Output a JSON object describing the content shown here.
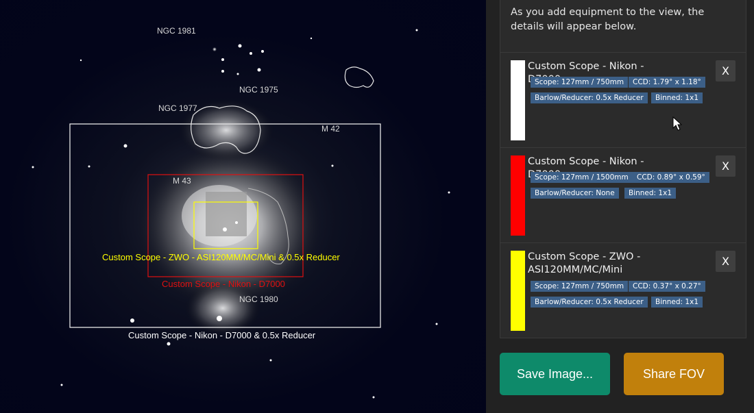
{
  "sky": {
    "objects": [
      {
        "id": "ngc1981",
        "label": "NGC 1981"
      },
      {
        "id": "ngc1975",
        "label": "NGC 1975"
      },
      {
        "id": "ngc1977",
        "label": "NGC 1977"
      },
      {
        "id": "m42",
        "label": "M 42"
      },
      {
        "id": "m43",
        "label": "M 43"
      },
      {
        "id": "ngc1980",
        "label": "NGC 1980"
      }
    ],
    "fov_labels": {
      "yellow": "Custom Scope - ZWO - ASI120MM/MC/Mini  & 0.5x Reducer",
      "red": "Custom Scope - Nikon - D7000",
      "white": "Custom Scope - Nikon - D7000  & 0.5x Reducer"
    },
    "colors": {
      "white": "#ffffff",
      "red": "#e01010",
      "yellow": "#ffff00"
    }
  },
  "sidebar": {
    "intro": "As you add equipment to the view, the details will appear below.",
    "equipment": [
      {
        "name": "Custom Scope - Nikon - D7000",
        "color": "#ffffff",
        "scope": "Scope: 127mm / 750mm",
        "ccd": "CCD: 1.79° x 1.18°",
        "reducer": "Barlow/Reducer: 0.5x Reducer",
        "binned": "Binned: 1x1",
        "remove": "X"
      },
      {
        "name": "Custom Scope - Nikon - D7000",
        "color": "#ff0000",
        "scope": "Scope: 127mm / 1500mm",
        "ccd": "CCD: 0.89° x 0.59°",
        "reducer": "Barlow/Reducer: None",
        "binned": "Binned: 1x1",
        "remove": "X"
      },
      {
        "name": "Custom Scope - ZWO - ASI120MM/MC/Mini",
        "color": "#ffff00",
        "scope": "Scope: 127mm / 750mm",
        "ccd": "CCD: 0.37° x 0.27°",
        "reducer": "Barlow/Reducer: 0.5x Reducer",
        "binned": "Binned: 1x1",
        "remove": "X"
      }
    ],
    "save_label": "Save Image...",
    "share_label": "Share FOV"
  }
}
